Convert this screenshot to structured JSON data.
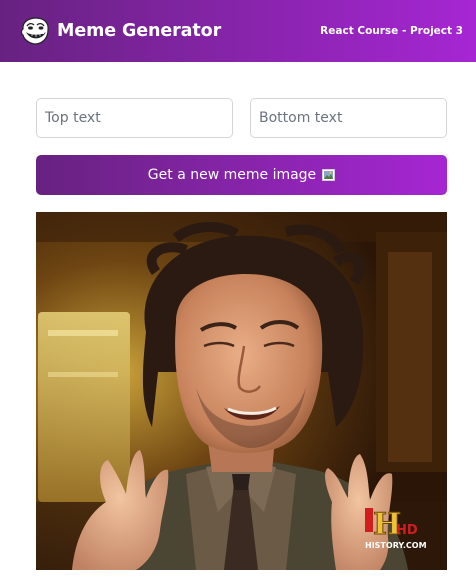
{
  "header": {
    "title": "Meme Generator",
    "subtitle": "React Course - Project 3",
    "logo_icon": "troll-face-icon"
  },
  "form": {
    "top_text": {
      "value": "",
      "placeholder": "Top text"
    },
    "bottom_text": {
      "value": "",
      "placeholder": "Bottom text"
    },
    "button_label": "Get a new meme image",
    "button_icon": "picture-frame-icon"
  },
  "meme": {
    "image": "ancient-aliens-guy-meme",
    "watermark": {
      "letter": "H",
      "badge": "HD",
      "site": "HISTORY.COM"
    }
  },
  "colors": {
    "gradient_start": "#672280",
    "gradient_end": "#A626D3",
    "input_border": "#D5D4D8"
  }
}
